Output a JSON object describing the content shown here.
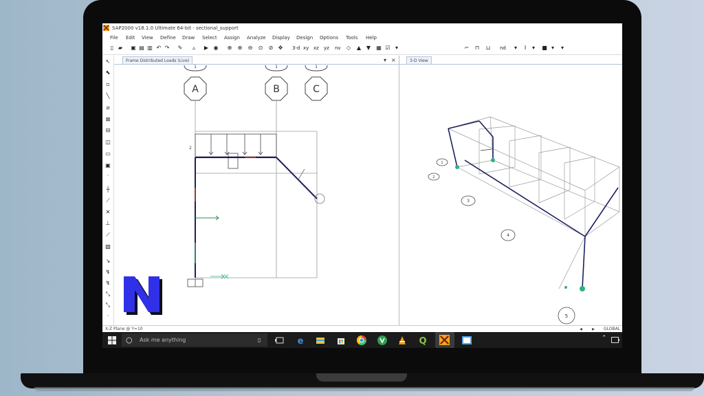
{
  "window": {
    "title": "SAP2000 v18.1.0 Ultimate 64-bit - sectional_support"
  },
  "menu": [
    "File",
    "Edit",
    "View",
    "Define",
    "Draw",
    "Select",
    "Assign",
    "Analyze",
    "Display",
    "Design",
    "Options",
    "Tools",
    "Help"
  ],
  "toolbar": {
    "view_labels": [
      "3-d",
      "xy",
      "xz",
      "yz",
      "nv"
    ],
    "extra_label": "nd"
  },
  "left_pane": {
    "tab_title": "Frame Distributed Loads (Live)",
    "pin_label": "▾",
    "close_label": "×",
    "grid_labels": [
      "A",
      "B",
      "C"
    ],
    "top_markers": [
      "1",
      "1",
      "1"
    ],
    "beam_label": "2"
  },
  "right_pane": {
    "tab_title": "3-D View",
    "joint_labels": [
      "1",
      "2",
      "3",
      "4",
      "5"
    ]
  },
  "status": {
    "left": "X-Z Plane @ Y=10",
    "right": "GLOBAL"
  },
  "taskbar": {
    "search_placeholder": "Ask me anything"
  },
  "colors": {
    "frame": "#1a1f5c",
    "grid": "#9a9a9a",
    "load_arrow": "#c0392b",
    "axis_green": "#2e8b57",
    "support_green": "#2fb27a",
    "logo_blue": "#3030e8",
    "logo_shadow": "#0d0d20"
  }
}
